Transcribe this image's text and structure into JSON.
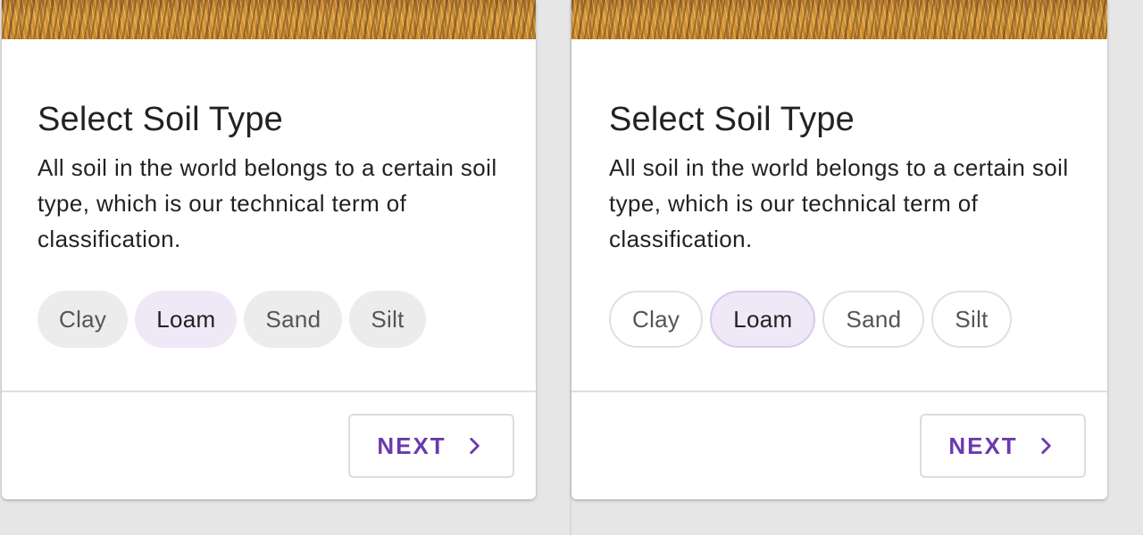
{
  "cards": [
    {
      "variant": "filled",
      "title": "Select Soil Type",
      "description": "All soil in the world belongs to a certain soil type, which is our technical term of classification.",
      "chips": [
        {
          "label": "Clay",
          "selected": false
        },
        {
          "label": "Loam",
          "selected": true
        },
        {
          "label": "Sand",
          "selected": false
        },
        {
          "label": "Silt",
          "selected": false
        }
      ],
      "next_label": "NEXT",
      "next_icon": "chevron-right-icon"
    },
    {
      "variant": "outlined",
      "title": "Select Soil Type",
      "description": "All soil in the world belongs to a certain soil type, which is our technical term of classification.",
      "chips": [
        {
          "label": "Clay",
          "selected": false
        },
        {
          "label": "Loam",
          "selected": true
        },
        {
          "label": "Sand",
          "selected": false
        },
        {
          "label": "Silt",
          "selected": false
        }
      ],
      "next_label": "NEXT",
      "next_icon": "chevron-right-icon"
    }
  ],
  "colors": {
    "accent": "#6a3aae",
    "selected_chip_bg": "#efe8f7",
    "chip_bg": "#ececec",
    "page_bg": "#e6e6e6"
  }
}
